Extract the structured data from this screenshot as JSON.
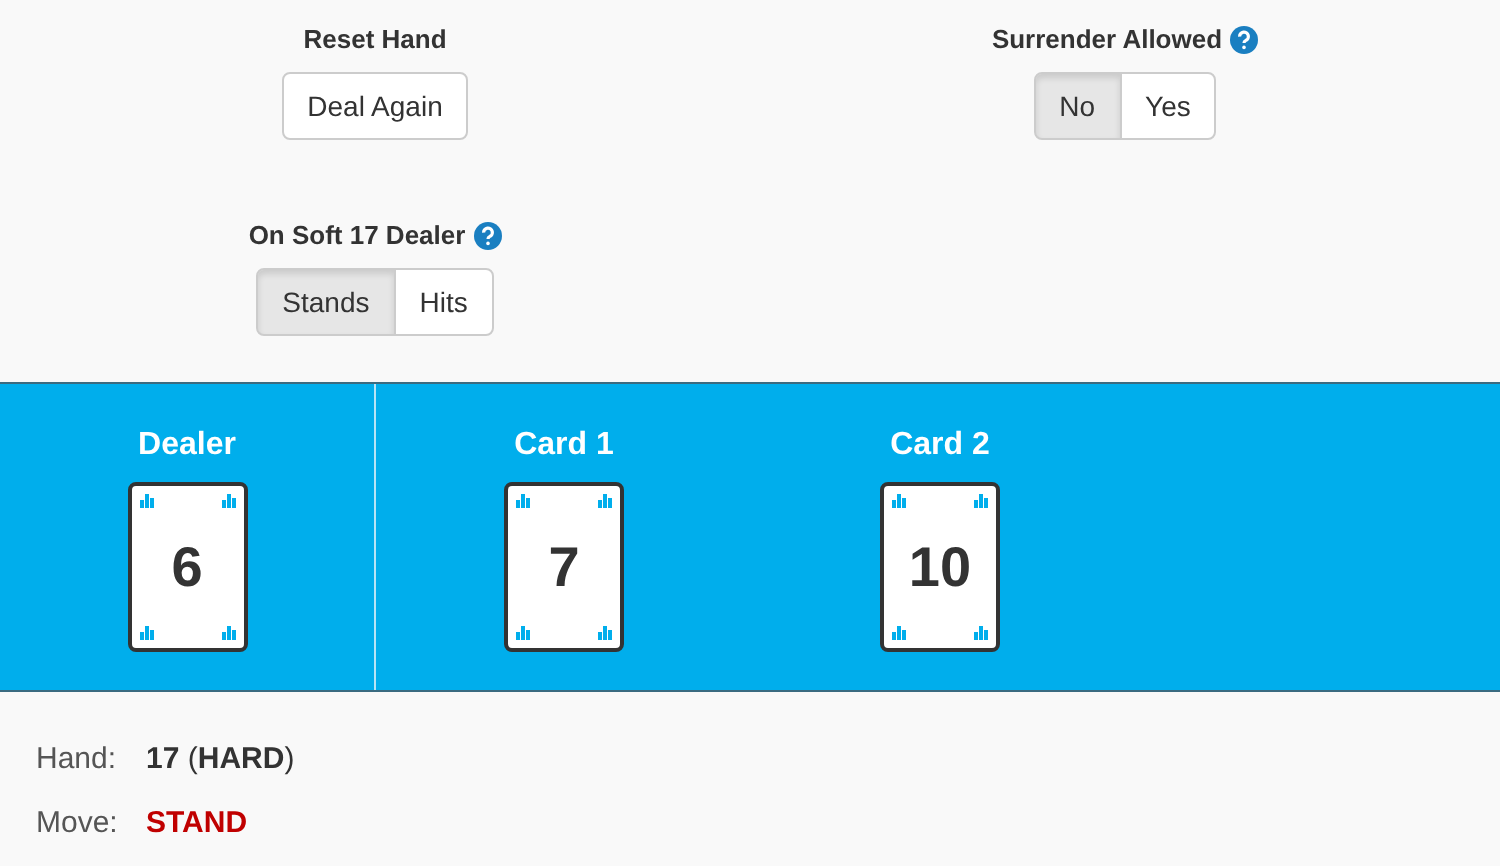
{
  "settings": [
    {
      "label": "Reset Hand",
      "help": false,
      "kind": "button",
      "options": [
        {
          "label": "Deal Again",
          "selected": false
        }
      ]
    },
    {
      "label": "Surrender Allowed",
      "help": true,
      "kind": "toggle",
      "options": [
        {
          "label": "No",
          "selected": true
        },
        {
          "label": "Yes",
          "selected": false
        }
      ]
    },
    {
      "label": "On Soft 17 Dealer",
      "help": true,
      "kind": "toggle",
      "options": [
        {
          "label": "Stands",
          "selected": true
        },
        {
          "label": "Hits",
          "selected": false
        }
      ]
    }
  ],
  "dealer": {
    "label": "Dealer",
    "card": "6"
  },
  "player_cards": [
    {
      "label": "Card 1",
      "card": "7"
    },
    {
      "label": "Card 2",
      "card": "10"
    }
  ],
  "result": [
    {
      "label": "Hand:",
      "value": "**17** (**HARD**)",
      "kind": "hand"
    },
    {
      "label": "Move:",
      "value": "STAND",
      "kind": "move"
    }
  ]
}
